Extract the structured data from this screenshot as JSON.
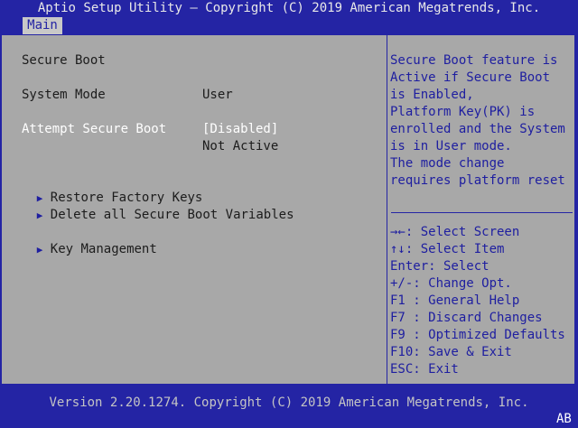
{
  "header": {
    "title": "Aptio Setup Utility – Copyright (C) 2019 American Megatrends, Inc.",
    "tab_main": "Main"
  },
  "main": {
    "secure_boot_label": "Secure Boot",
    "system_mode_label": "System Mode",
    "system_mode_value": "User",
    "attempt_secure_boot_label": "Attempt Secure Boot",
    "attempt_secure_boot_value": "[Disabled]",
    "secure_boot_status": "Not Active",
    "restore_factory_keys": "Restore Factory Keys",
    "delete_all_variables": "Delete all Secure Boot Variables",
    "key_management": "Key Management"
  },
  "help": {
    "lines": [
      "Secure Boot feature is",
      "Active if Secure Boot",
      "is Enabled,",
      "Platform Key(PK) is",
      "enrolled and the System",
      "is in User mode.",
      "The mode change",
      "requires platform reset"
    ]
  },
  "keys": [
    "→←: Select Screen",
    "↑↓: Select Item",
    "Enter: Select",
    "+/-: Change Opt.",
    "F1 : General Help",
    "F7 : Discard Changes",
    "F9 : Optimized Defaults",
    "F10: Save & Exit",
    "ESC: Exit"
  ],
  "footer": {
    "version": "Version 2.20.1274. Copyright (C) 2019 American Megatrends, Inc.",
    "corner": "AB"
  },
  "colors": {
    "background": "#2424a4",
    "panel": "#a8a8a8",
    "highlight_text": "#ffffff",
    "help_text": "#1e1ea0"
  }
}
